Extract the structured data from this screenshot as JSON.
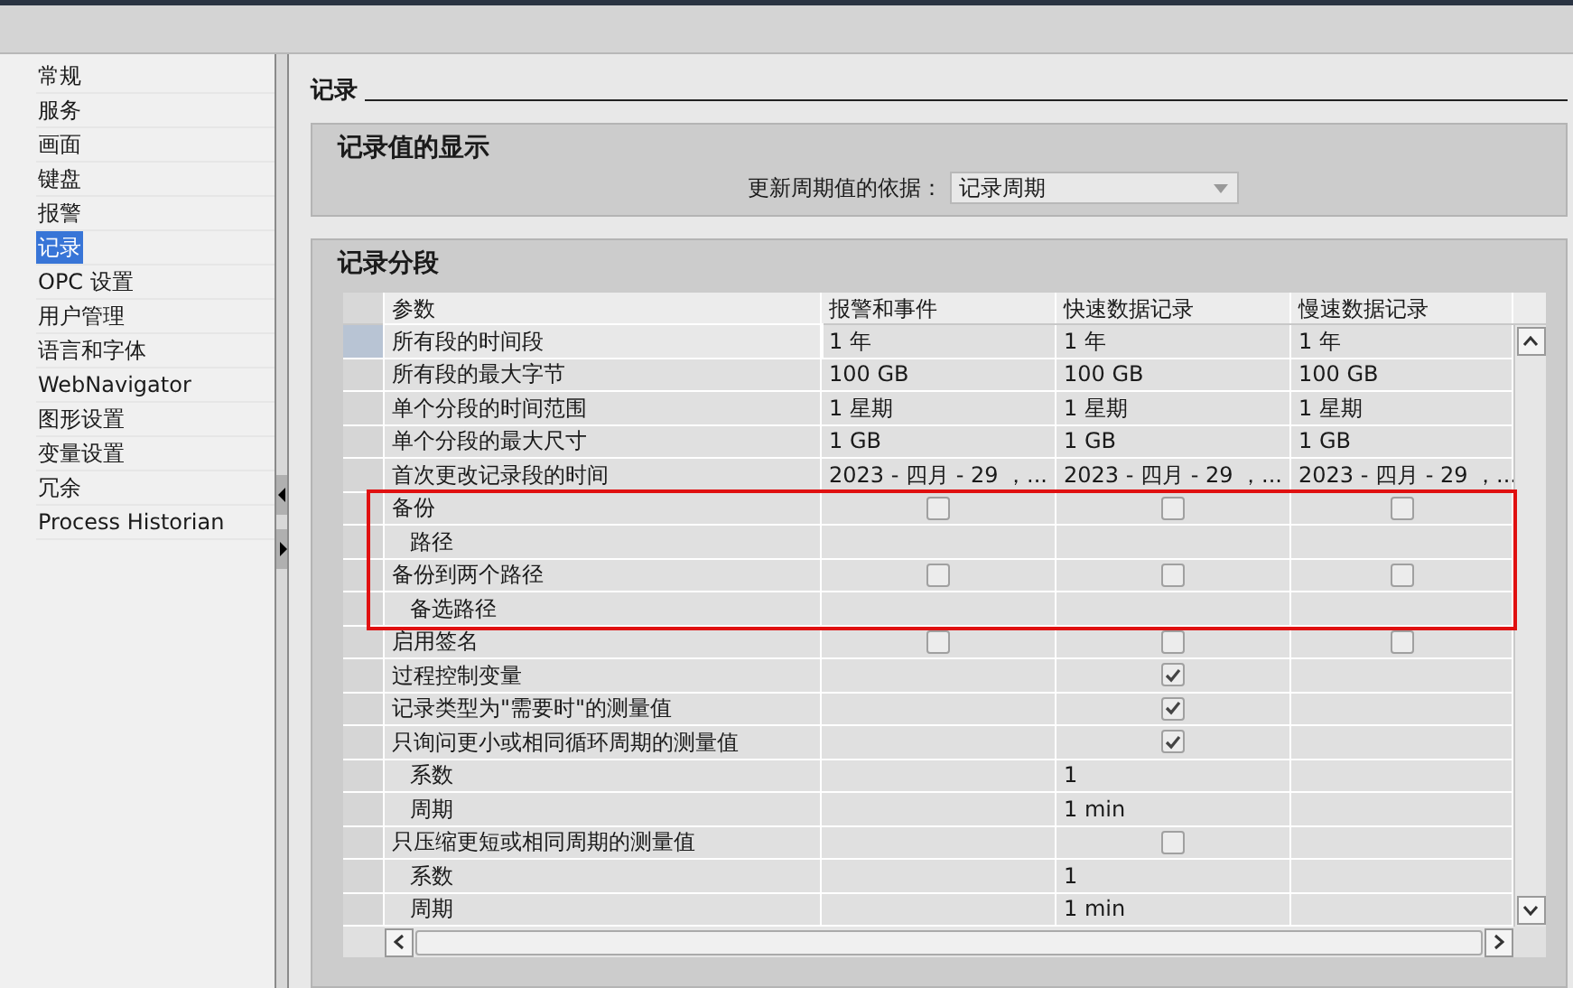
{
  "sidebar": {
    "items": [
      {
        "label": "常规",
        "selected": false
      },
      {
        "label": "服务",
        "selected": false
      },
      {
        "label": "画面",
        "selected": false
      },
      {
        "label": "键盘",
        "selected": false
      },
      {
        "label": "报警",
        "selected": false
      },
      {
        "label": "记录",
        "selected": true
      },
      {
        "label": "OPC 设置",
        "selected": false
      },
      {
        "label": "用户管理",
        "selected": false
      },
      {
        "label": "语言和字体",
        "selected": false
      },
      {
        "label": "WebNavigator",
        "selected": false
      },
      {
        "label": "图形设置",
        "selected": false
      },
      {
        "label": "变量设置",
        "selected": false
      },
      {
        "label": "冗余",
        "selected": false
      },
      {
        "label": "Process Historian",
        "selected": false
      }
    ]
  },
  "page_title": "记录",
  "display_section": {
    "title": "记录值的显示",
    "field_label": "更新周期值的依据：",
    "dropdown": {
      "value": "记录周期"
    }
  },
  "segment_section": {
    "title": "记录分段",
    "table": {
      "parameter_header": "参数",
      "columns": [
        "报警和事件",
        "快速数据记录",
        "慢速数据记录"
      ],
      "rows": [
        {
          "label": "所有段的时间段",
          "selected": true,
          "cells": [
            {
              "kind": "text",
              "text": "1 年"
            },
            {
              "kind": "text",
              "text": "1 年"
            },
            {
              "kind": "text",
              "text": "1 年"
            }
          ]
        },
        {
          "label": "所有段的最大字节",
          "selected": false,
          "cells": [
            {
              "kind": "text",
              "text": "100 GB"
            },
            {
              "kind": "text",
              "text": "100 GB"
            },
            {
              "kind": "text",
              "text": "100 GB"
            }
          ]
        },
        {
          "label": "单个分段的时间范围",
          "selected": false,
          "cells": [
            {
              "kind": "text",
              "text": "1 星期"
            },
            {
              "kind": "text",
              "text": "1 星期"
            },
            {
              "kind": "text",
              "text": "1 星期"
            }
          ]
        },
        {
          "label": "单个分段的最大尺寸",
          "selected": false,
          "cells": [
            {
              "kind": "text",
              "text": "1 GB"
            },
            {
              "kind": "text",
              "text": "1 GB"
            },
            {
              "kind": "text",
              "text": "1 GB"
            }
          ]
        },
        {
          "label": "首次更改记录段的时间",
          "selected": false,
          "cells": [
            {
              "kind": "text",
              "text": "2023 - 四月  - 29 ，..."
            },
            {
              "kind": "text",
              "text": "2023 - 四月  - 29 ，..."
            },
            {
              "kind": "text",
              "text": "2023 - 四月  - 29 ，..."
            }
          ]
        },
        {
          "label": "备份",
          "selected": false,
          "cells": [
            {
              "kind": "checkbox",
              "checked": false
            },
            {
              "kind": "checkbox",
              "checked": false
            },
            {
              "kind": "checkbox",
              "checked": false
            }
          ],
          "children": [
            {
              "label": "路径",
              "selected": false,
              "cells": [
                {
                  "kind": "empty"
                },
                {
                  "kind": "empty"
                },
                {
                  "kind": "empty"
                }
              ]
            }
          ]
        },
        {
          "label": "备份到两个路径",
          "selected": false,
          "cells": [
            {
              "kind": "checkbox",
              "checked": false
            },
            {
              "kind": "checkbox",
              "checked": false
            },
            {
              "kind": "checkbox",
              "checked": false
            }
          ],
          "children": [
            {
              "label": "备选路径",
              "selected": false,
              "cells": [
                {
                  "kind": "empty"
                },
                {
                  "kind": "empty"
                },
                {
                  "kind": "empty"
                }
              ]
            }
          ]
        },
        {
          "label": "启用签名",
          "selected": false,
          "cells": [
            {
              "kind": "checkbox",
              "checked": false
            },
            {
              "kind": "checkbox",
              "checked": false
            },
            {
              "kind": "checkbox",
              "checked": false
            }
          ]
        },
        {
          "label": "过程控制变量",
          "selected": false,
          "cells": [
            {
              "kind": "empty"
            },
            {
              "kind": "checkbox",
              "checked": true
            },
            {
              "kind": "empty"
            }
          ]
        },
        {
          "label": "记录类型为\"需要时\"的测量值",
          "selected": false,
          "cells": [
            {
              "kind": "empty"
            },
            {
              "kind": "checkbox",
              "checked": true
            },
            {
              "kind": "empty"
            }
          ]
        },
        {
          "label": "只询问更小或相同循环周期的测量值",
          "selected": false,
          "cells": [
            {
              "kind": "empty"
            },
            {
              "kind": "checkbox",
              "checked": true
            },
            {
              "kind": "empty"
            }
          ],
          "children": [
            {
              "label": "系数",
              "selected": false,
              "cells": [
                {
                  "kind": "empty"
                },
                {
                  "kind": "text",
                  "text": "1"
                },
                {
                  "kind": "empty"
                }
              ]
            },
            {
              "label": "周期",
              "selected": false,
              "cells": [
                {
                  "kind": "empty"
                },
                {
                  "kind": "text",
                  "text": "1 min"
                },
                {
                  "kind": "empty"
                }
              ]
            }
          ]
        },
        {
          "label": "只压缩更短或相同周期的测量值",
          "selected": false,
          "cells": [
            {
              "kind": "empty"
            },
            {
              "kind": "checkbox",
              "checked": false
            },
            {
              "kind": "empty"
            }
          ],
          "children": [
            {
              "label": "系数",
              "selected": false,
              "cells": [
                {
                  "kind": "empty"
                },
                {
                  "kind": "text",
                  "text": "1"
                },
                {
                  "kind": "empty"
                }
              ]
            },
            {
              "label": "周期",
              "selected": false,
              "cells": [
                {
                  "kind": "empty"
                },
                {
                  "kind": "text",
                  "text": "1 min"
                },
                {
                  "kind": "empty"
                }
              ]
            }
          ]
        }
      ]
    }
  }
}
